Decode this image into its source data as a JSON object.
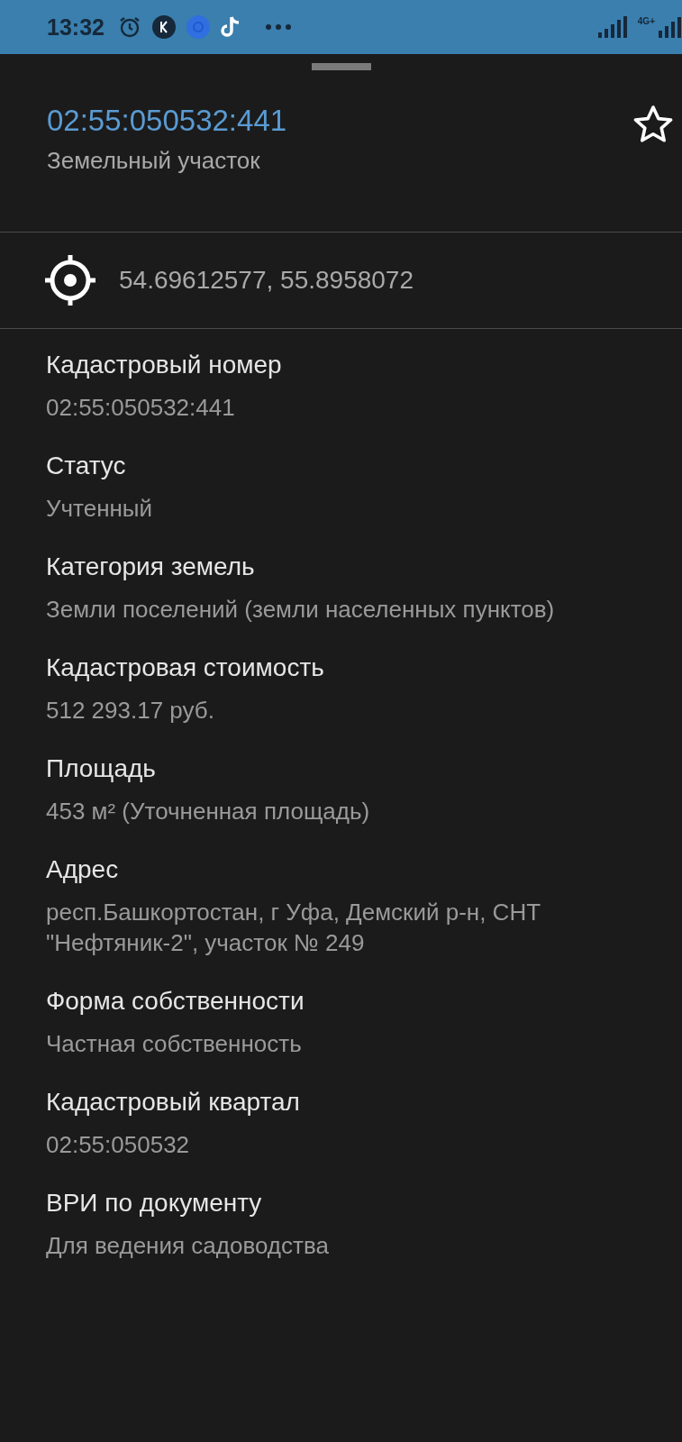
{
  "status_bar": {
    "time": "13:32",
    "network": "4G+"
  },
  "header": {
    "title": "02:55:050532:441",
    "subtitle": "Земельный участок",
    "favorite": false
  },
  "coordinates": "54.69612577, 55.8958072",
  "fields": [
    {
      "label": "Кадастровый номер",
      "value": "02:55:050532:441"
    },
    {
      "label": "Статус",
      "value": "Учтенный"
    },
    {
      "label": "Категория земель",
      "value": "Земли поселений (земли населенных пунктов)"
    },
    {
      "label": "Кадастровая стоимость",
      "value": "512 293.17 руб."
    },
    {
      "label": "Площадь",
      "value": "453 м² (Уточненная площадь)"
    },
    {
      "label": "Адрес",
      "value": "респ.Башкортостан, г Уфа, Демский р-н, СНТ \"Нефтяник-2\", участок № 249"
    },
    {
      "label": "Форма собственности",
      "value": "Частная собственность"
    },
    {
      "label": "Кадастровый квартал",
      "value": "02:55:050532"
    },
    {
      "label": "ВРИ по документу",
      "value": "Для ведения садоводства"
    }
  ]
}
